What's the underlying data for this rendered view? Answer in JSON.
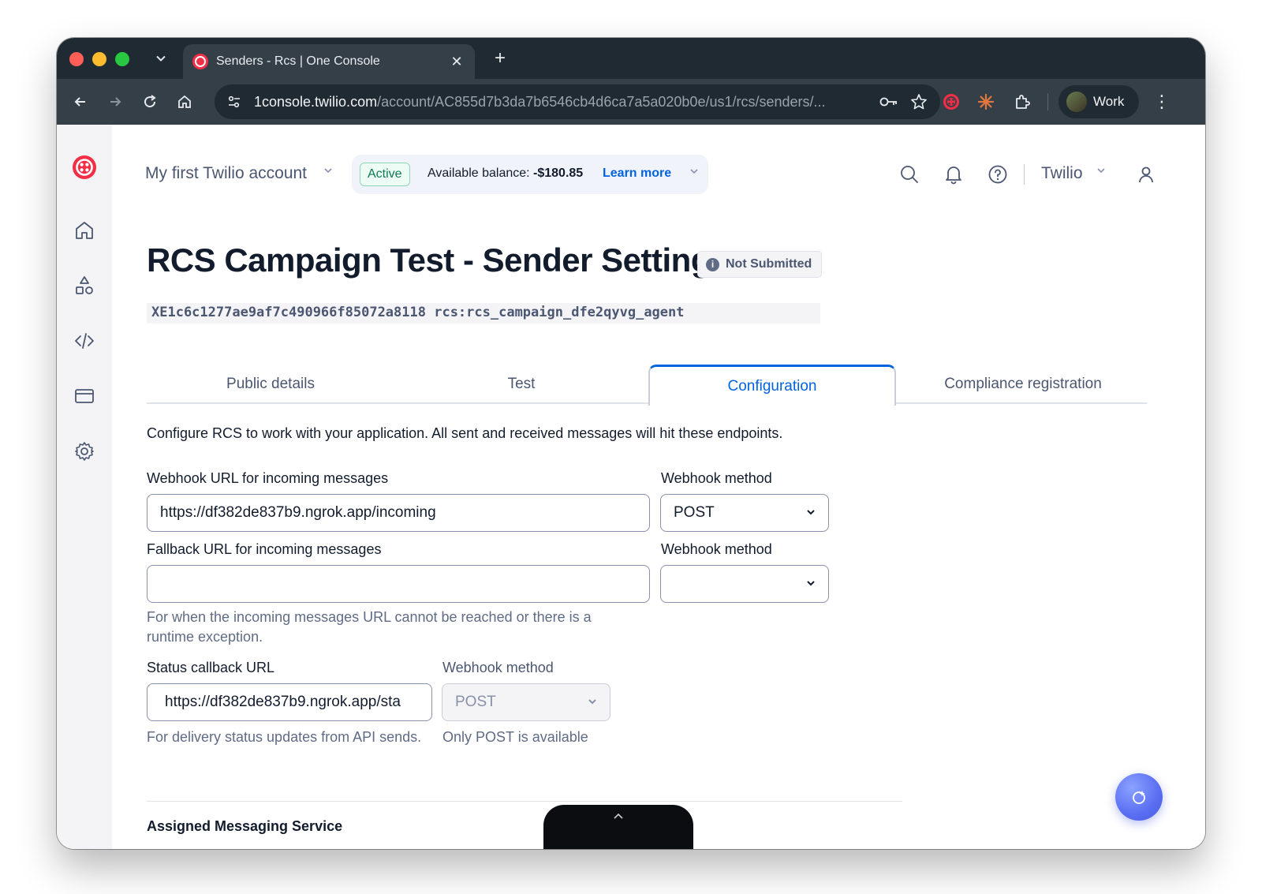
{
  "browser": {
    "tab_title": "Senders - Rcs | One Console",
    "url_host": "1console.twilio.com",
    "url_path": "/account/AC855d7b3da7b6546cb4d6ca7a5a020b0e/us1/rcs/senders/...",
    "profile_label": "Work"
  },
  "topbar": {
    "account_name": "My first Twilio account",
    "status_badge": "Active",
    "balance_label": "Available balance: ",
    "balance_value": "-$180.85",
    "learn_more": "Learn more",
    "org_name": "Twilio"
  },
  "page": {
    "title": "RCS Campaign Test - Sender Settings",
    "status": "Not Submitted",
    "sid": "XE1c6c1277ae9af7c490966f85072a8118 rcs:rcs_campaign_dfe2qyvg_agent"
  },
  "tabs": [
    {
      "label": "Public details",
      "active": false
    },
    {
      "label": "Test",
      "active": false
    },
    {
      "label": "Configuration",
      "active": true
    },
    {
      "label": "Compliance registration",
      "active": false
    }
  ],
  "config": {
    "description": "Configure RCS to work with your application. All sent and received messages will hit these endpoints.",
    "incoming": {
      "label": "Webhook URL for incoming messages",
      "value": "https://df382de837b9.ngrok.app/incoming",
      "method_label": "Webhook method",
      "method_value": "POST"
    },
    "fallback": {
      "label": "Fallback URL for incoming messages",
      "value": "",
      "method_label": "Webhook method",
      "method_value": "",
      "help": "For when the incoming messages URL cannot be reached or there is a runtime exception."
    },
    "status_callback": {
      "label": "Status callback URL",
      "value": "https://df382de837b9.ngrok.app/sta",
      "help": "For delivery status updates from API sends.",
      "method_label": "Webhook method",
      "method_value": "POST",
      "method_help": "Only POST is available"
    },
    "assigned_section": "Assigned Messaging Service"
  },
  "colors": {
    "accent": "#0263e0",
    "brand_red": "#f22f46",
    "active_green": "#0c7a53"
  }
}
